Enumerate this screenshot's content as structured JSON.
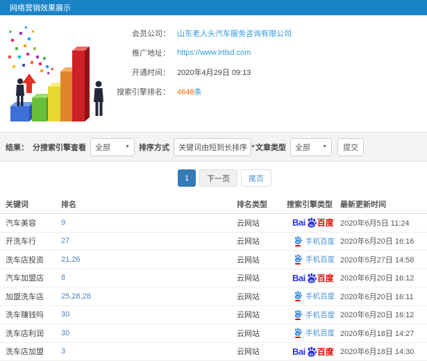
{
  "header": {
    "title": "网络营销效果展示"
  },
  "info": {
    "rows": [
      {
        "label": "会员公司：",
        "value": "山东老人头汽车服务咨询有限公司"
      },
      {
        "label": "推广地址：",
        "value": "https://www.lrtlsd.com"
      },
      {
        "label": "开通时间：",
        "value": "2020年4月29日 09:13"
      },
      {
        "label": "搜索引擎排名：",
        "value": "4648",
        "suffix": "条"
      }
    ]
  },
  "filters": {
    "result_label": "结果：",
    "engine_label": "分搜索引擎查看",
    "engine_value": "全部",
    "sort_label": "排序方式",
    "sort_value": "关键词由短到长排序",
    "article_label": "文章类型",
    "article_value": "全部",
    "submit_label": "提交",
    "caret": "▼"
  },
  "pagination": {
    "current": "1",
    "next": "下一页",
    "last": "尾页"
  },
  "table": {
    "headers": [
      "关键词",
      "排名",
      "排名类型",
      "搜索引擎类型",
      "最新更新时间"
    ],
    "rows": [
      {
        "keyword": "汽车美容",
        "rank": "9",
        "rank_type": "云网站",
        "engine": "baidu",
        "updated": "2020年6月5日 11:24"
      },
      {
        "keyword": "开洗车行",
        "rank": "27",
        "rank_type": "云网站",
        "engine": "mobile-baidu",
        "updated": "2020年6月20日 16:16"
      },
      {
        "keyword": "洗车店投资",
        "rank": "21,26",
        "rank_type": "云网站",
        "engine": "mobile-baidu",
        "updated": "2020年5月27日 14:58"
      },
      {
        "keyword": "汽车加盟店",
        "rank": "8",
        "rank_type": "云网站",
        "engine": "baidu",
        "updated": "2020年6月20日 16:12"
      },
      {
        "keyword": "加盟洗车店",
        "rank": "25,28,28",
        "rank_type": "云网站",
        "engine": "mobile-baidu",
        "updated": "2020年6月20日 16:11"
      },
      {
        "keyword": "洗车赚钱吗",
        "rank": "30",
        "rank_type": "云网站",
        "engine": "mobile-baidu",
        "updated": "2020年6月20日 16:12"
      },
      {
        "keyword": "洗车店利润",
        "rank": "30",
        "rank_type": "云网站",
        "engine": "mobile-baidu",
        "updated": "2020年6月18日 14:27"
      },
      {
        "keyword": "洗车店加盟",
        "rank": "3",
        "rank_type": "云网站",
        "engine": "baidu",
        "updated": "2020年6月18日 14:30"
      }
    ]
  },
  "engine_labels": {
    "baidu_bai": "Bai",
    "baidu_du": "du",
    "baidu_cn": "百度",
    "mobile_text": "手机百度"
  },
  "colors": {
    "header_bg": "#1a83c6",
    "link_blue": "#2e9bd6",
    "highlight_orange": "#ff6600",
    "rank_blue": "#4d7fbe",
    "pagination_active": "#337ab7",
    "baidu_blue": "#2932e1",
    "baidu_red": "#e10602",
    "mobile_baidu_blue": "#4a90d2"
  }
}
